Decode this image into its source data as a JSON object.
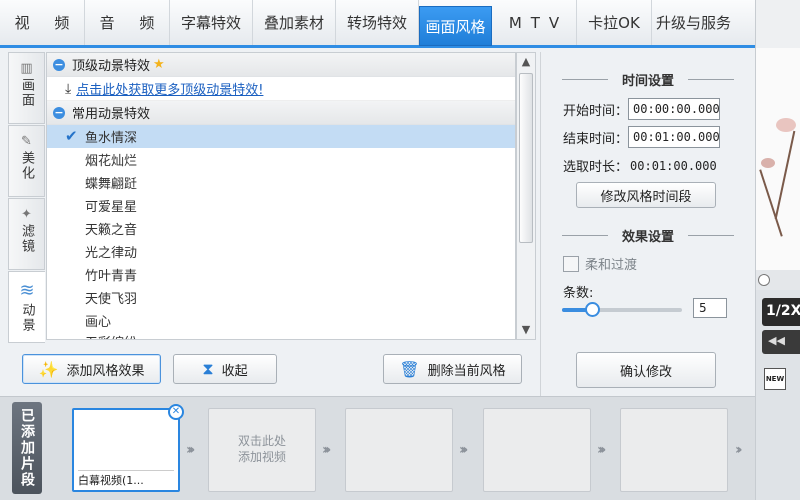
{
  "tabs": [
    {
      "label": "视 频",
      "active": false
    },
    {
      "label": "音 频",
      "active": false
    },
    {
      "label": "字幕特效",
      "active": false
    },
    {
      "label": "叠加素材",
      "active": false
    },
    {
      "label": "转场特效",
      "active": false
    },
    {
      "label": "画面风格",
      "active": true
    },
    {
      "label": "MTV",
      "active": false
    },
    {
      "label": "卡拉OK",
      "active": false
    },
    {
      "label": "升级与服务",
      "active": false
    }
  ],
  "side_tabs": [
    {
      "label": "画面",
      "icon": "film-strip-icon"
    },
    {
      "label": "美化",
      "icon": "magic-wand-icon"
    },
    {
      "label": "滤镜",
      "icon": "sparkle-wand-icon"
    },
    {
      "label": "动景",
      "icon": "waves-icon",
      "active": true
    }
  ],
  "list": {
    "group_premium": "顶级动景特效",
    "premium_link": "点击此处获取更多顶级动景特效!",
    "group_common": "常用动景特效",
    "items": [
      "鱼水情深",
      "烟花灿烂",
      "蝶舞翩跹",
      "可爱星星",
      "天籁之音",
      "光之律动",
      "竹叶青青",
      "天使飞羽",
      "画心",
      "五彩缤纷"
    ],
    "selected_index": 0
  },
  "buttons": {
    "add_effect": "添加风格效果",
    "collapse": "收起",
    "delete_current": "删除当前风格",
    "modify_time": "修改风格时间段",
    "confirm": "确认修改"
  },
  "time_settings": {
    "title": "时间设置",
    "start_label": "开始时间：",
    "start_value": "00:00:00.000",
    "end_label": "结束时间：",
    "end_value": "00:01:00.000",
    "duration_label": "选取时长：",
    "duration_value": "00:01:00.000"
  },
  "effect_settings": {
    "title": "效果设置",
    "smooth_label": "柔和过渡",
    "smooth_checked": false,
    "count_label": "条数:",
    "count_value": "5",
    "slider_fraction": 0.25
  },
  "clips": {
    "strip_label": "已添加片段",
    "first_caption": "白幕视频(1...",
    "add_hint_line1": "双击此处",
    "add_hint_line2": "添加视频"
  },
  "preview": {
    "speed": "1/2X",
    "new_badge": "NEW"
  }
}
